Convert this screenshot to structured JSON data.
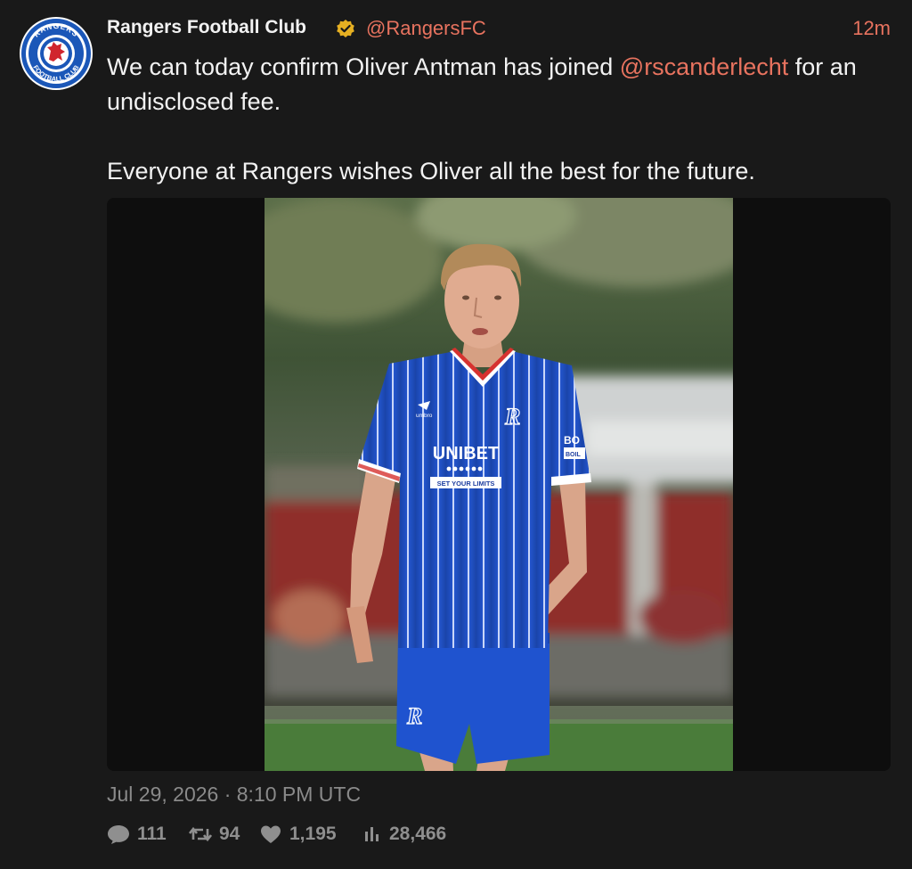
{
  "tweet": {
    "author_name": "Rangers Football Club",
    "handle": "@RangersFC",
    "time_ago": "12m",
    "text_before_mention": "We can today confirm Oliver Antman has joined ",
    "mention": "@rscanderlecht",
    "text_after_mention": " for an undisclosed fee.",
    "paragraph2": "Everyone at Rangers wishes Oliver all the best for the future.",
    "date": "Jul 29, 2026 · 8:10 PM UTC",
    "replies": "111",
    "retweets": "94",
    "likes": "1,195",
    "views": "28,466"
  },
  "avatar": {
    "top_text": "RANGERS",
    "bottom_text": "FOOTBALL CLUB",
    "ring_color": "#1b57b8",
    "lion_color": "#d0252d"
  },
  "photo": {
    "shirt_sponsor": "UNIBET",
    "shirt_tagline": "SET YOUR LIMITS",
    "sleeve_sponsor": "BO",
    "sleeve_sponsor_sub": "BOIL",
    "kit_brand": "umbro",
    "shirt_color": "#1f4fc4"
  },
  "colors": {
    "accent": "#e8735f",
    "verified": "#e6b022",
    "muted": "#8a8a8a"
  },
  "icons": [
    "verified-badge-icon",
    "reply-icon",
    "retweet-icon",
    "like-icon",
    "views-icon"
  ]
}
